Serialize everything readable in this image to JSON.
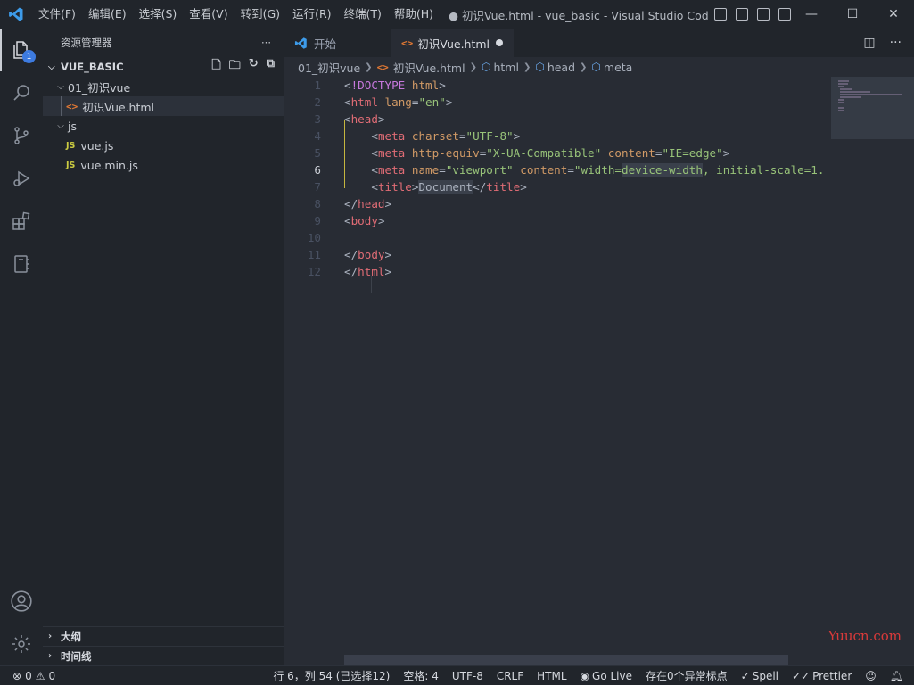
{
  "window": {
    "title": "● 初识Vue.html - vue_basic - Visual Studio Code [管",
    "menu": [
      "文件(F)",
      "编辑(E)",
      "选择(S)",
      "查看(V)",
      "转到(G)",
      "运行(R)",
      "终端(T)",
      "帮助(H)"
    ],
    "controls": {
      "minimize": "—",
      "maximize": "☐",
      "close": "✕"
    },
    "accent_color": "#3d7be0"
  },
  "activity_bar": {
    "explorer_badge": "1",
    "items": [
      "files-icon",
      "search-icon",
      "source-control-icon",
      "run-debug-icon",
      "extensions-icon",
      "notebook-icon"
    ],
    "bottom_items": [
      "account-icon",
      "settings-gear-icon"
    ]
  },
  "sidebar": {
    "title": "资源管理器",
    "more": "···",
    "section_title": "VUE_BASIC",
    "tree": {
      "folder1": "01_初识vue",
      "file_html": "初识Vue.html",
      "folder_js": "js",
      "file_vuejs": "vue.js",
      "file_vueminjs": "vue.min.js",
      "js_icon_label": "JS"
    },
    "outline": "大纲",
    "timeline": "时间线"
  },
  "editor": {
    "tabs": [
      {
        "label": "开始",
        "icon": "vscode-logo-icon"
      },
      {
        "label": "初识Vue.html",
        "icon": "html-icon",
        "modified": true
      }
    ],
    "breadcrumb": [
      "01_初识vue",
      "初识Vue.html",
      "html",
      "head",
      "meta"
    ],
    "line_numbers": [
      "1",
      "2",
      "3",
      "4",
      "5",
      "6",
      "7",
      "8",
      "9",
      "10",
      "11",
      "12"
    ],
    "current_line": 6,
    "watermark": "Yuucn.com"
  },
  "status": {
    "errors": "0",
    "warnings": "0",
    "position": "行 6，列 54 (已选择12)",
    "spaces": "空格: 4",
    "encoding": "UTF-8",
    "eol": "CRLF",
    "language": "HTML",
    "golive": "Go Live",
    "problems": "存在0个异常标点",
    "spell": "Spell",
    "prettier": "Prettier"
  }
}
